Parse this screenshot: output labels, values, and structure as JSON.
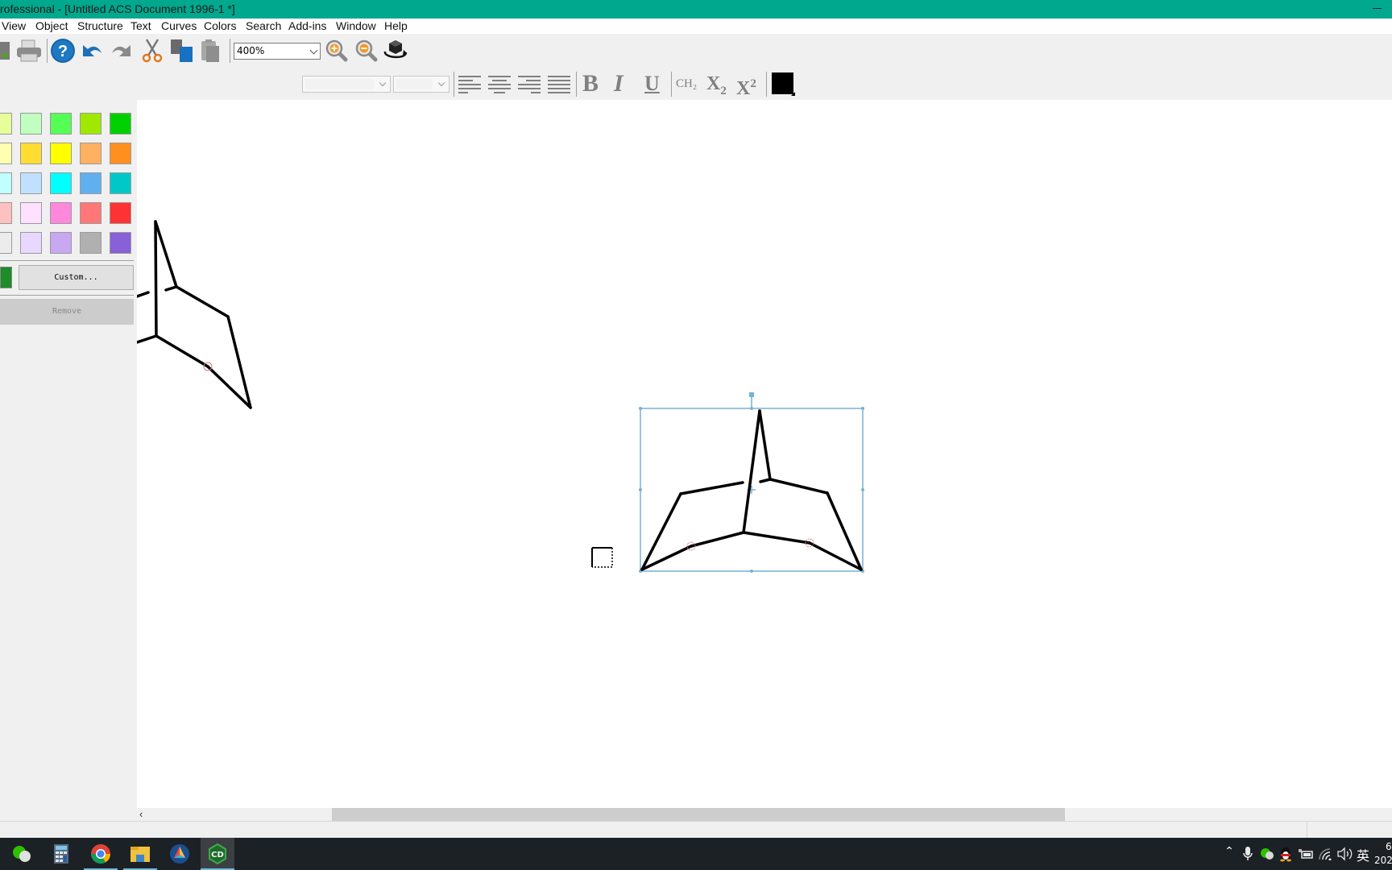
{
  "window": {
    "title": "rofessional - [Untitled ACS Document 1996-1 *]"
  },
  "menu": {
    "items": [
      "View",
      "Object",
      "Structure",
      "Text",
      "Curves",
      "Colors",
      "Search",
      "Add-ins",
      "Window",
      "Help"
    ]
  },
  "toolbar": {
    "zoom_value": "400%",
    "icons": [
      "save-icon",
      "print-icon",
      "help-icon",
      "undo-icon",
      "redo-icon",
      "cut-icon",
      "copy-icon",
      "paste-icon",
      "zoom-in-icon",
      "zoom-out-icon",
      "rotate-3d-icon"
    ]
  },
  "text_toolbar": {
    "font_value": "",
    "size_value": "",
    "bold": "B",
    "italic": "I",
    "underline": "U",
    "ch2": "CH₂",
    "subscript_base": "X",
    "subscript_sub": "2",
    "superscript_base": "X",
    "superscript_sup": "2",
    "text_color": "#000000"
  },
  "palette": {
    "rows": [
      [
        "#e6ff99",
        "#c0ffc0",
        "#55ff55",
        "#a0e800",
        "#00d000"
      ],
      [
        "#ffffb0",
        "#ffdd33",
        "#ffff00",
        "#ffb060",
        "#ff9020"
      ],
      [
        "#c0ffff",
        "#c0e0ff",
        "#00ffff",
        "#60b0f0",
        "#00c8c8"
      ],
      [
        "#ffc0c0",
        "#ffe0ff",
        "#ff88dd",
        "#ff7777",
        "#ff3333"
      ],
      [
        "#ececec",
        "#e8d8ff",
        "#c8a8f0",
        "#b0b0b0",
        "#8860d8"
      ]
    ],
    "current_color": "#1e8c28",
    "custom_label": "Custom...",
    "remove_label": "Remove"
  },
  "selection": {
    "color": "#78b0d4"
  },
  "taskbar": {
    "apps": [
      "wechat-icon",
      "calculator-icon",
      "chrome-icon",
      "file-explorer-icon",
      "app-icon",
      "chemdraw-icon"
    ],
    "active_app": "chemdraw-icon",
    "tray_ime": "英",
    "clock_line1": "6",
    "clock_line2": "202"
  }
}
